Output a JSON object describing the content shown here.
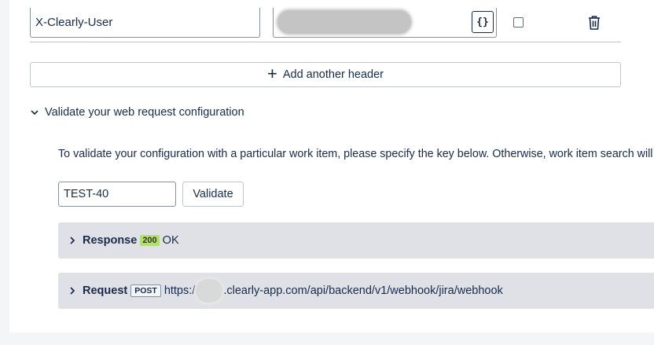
{
  "header_row": {
    "name_value": "X-Clearly-User",
    "format_button_label": "{}",
    "secret_checked": false
  },
  "add_header_button": {
    "label": "Add another header"
  },
  "validate_section": {
    "toggle_label": "Validate your web request configuration",
    "description": "To validate your configuration with a particular work item, please specify the key below. Otherwise, work item search will be performed.",
    "key_value": "TEST-40",
    "validate_button_label": "Validate"
  },
  "response": {
    "label": "Response",
    "status_code": "200",
    "status_text": "OK"
  },
  "request": {
    "label": "Request",
    "method": "POST",
    "url_prefix": "https:/",
    "url_suffix": ".clearly-app.com/api/backend/v1/webhook/jira/webhook"
  },
  "colors": {
    "status_ok_badge": "#b3df72",
    "panel_background": "#dfe1e6"
  }
}
